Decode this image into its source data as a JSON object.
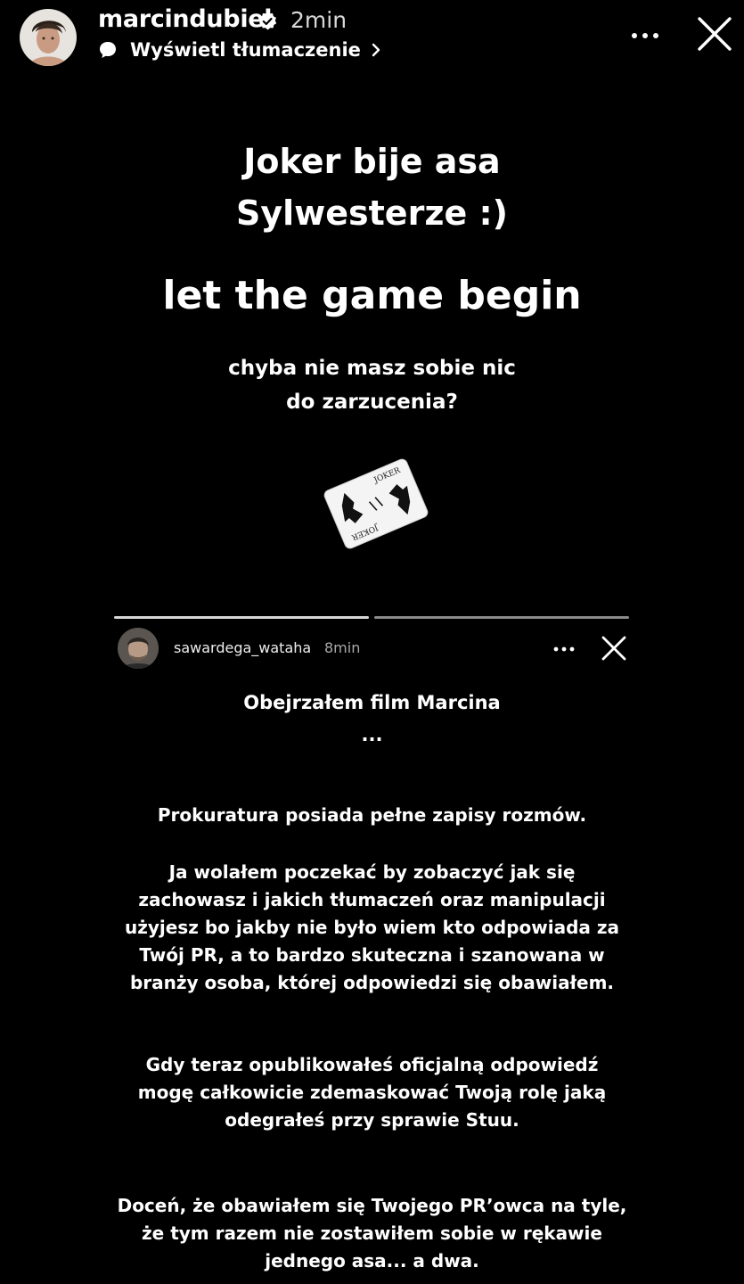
{
  "story": {
    "username": "marcindubiel",
    "time": "2min",
    "translate_label": "Wyświetl tłumaczenie",
    "accent": "#ffffff",
    "icons": {
      "verified": "verified-badge-icon",
      "translate": "speech-bubble-icon",
      "chevron": "chevron-right-icon",
      "more": "more-horizontal-icon",
      "close": "close-icon"
    }
  },
  "content": {
    "line1": "Joker bije asa",
    "line2": "Sylwesterze :)",
    "line3": "let the game begin",
    "line4": "chyba nie masz sobie nic",
    "line5": "do zarzucenia?",
    "card_label": "JOKER"
  },
  "embedded": {
    "username": "sawardega_wataha",
    "time": "8min",
    "heading": "Obejrzałem film Marcina",
    "ellipsis": "...",
    "para1": "Prokuratura posiada pełne zapisy rozmów.",
    "para2": "Ja wolałem poczekać by zobaczyć jak się zachowasz i jakich tłumaczeń oraz manipulacji użyjesz bo jakby nie było wiem kto odpowiada za Twój PR, a to bardzo skuteczna i szanowana w branży osoba, której odpowiedzi się obawiałem.",
    "para3": "Gdy teraz opublikowałeś oficjalną odpowiedź mogę całkowicie zdemaskować Twoją rolę jaką odegrałeś przy sprawie Stuu.",
    "para4": "Doceń, że obawiałem się Twojego PR’owca na tyle, że tym razem nie zostawiłem sobie w rękawie jednego asa... a dwa."
  }
}
